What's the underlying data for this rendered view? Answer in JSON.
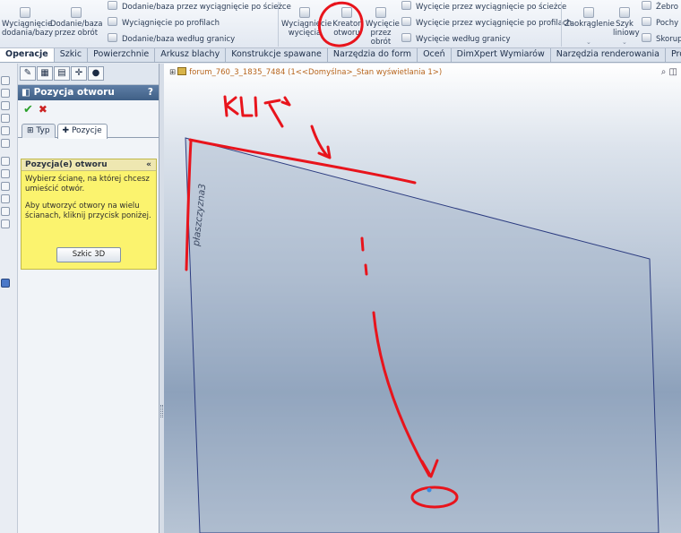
{
  "ribbon": {
    "btn_wyciagniecie": "Wyciągnięcie dodania/bazy",
    "btn_obrot": "Dodanie/baza przez obrót",
    "row_sciezka": "Dodanie/baza przez wyciągnięcie po ścieżce",
    "row_profile": "Wyciągnięcie po profilach",
    "row_granica": "Dodanie/baza według granicy",
    "btn_wyc_wyc": "Wyciągnięcie wycięcia",
    "btn_kreator": "Kreator otworu",
    "btn_wyc_obrot": "Wycięcie przez obrót",
    "row_cut_sciezka": "Wycięcie przez wyciągnięcie po ścieżce",
    "row_cut_profile": "Wycięcie przez wyciągnięcie po profilach",
    "row_cut_granica": "Wycięcie według granicy",
    "btn_zaokraglenie": "Zaokrąglenie",
    "btn_szyk": "Szyk liniowy",
    "row_zebro": "Żebro",
    "row_pochylenie": "Pochy",
    "row_skorupa": "Skorup"
  },
  "tabs": [
    "Operacje",
    "Szkic",
    "Powierzchnie",
    "Arkusz blachy",
    "Konstrukcje spawane",
    "Narzędzia do form",
    "Oceń",
    "DimXpert Wymiarów",
    "Narzędzia renderowania",
    "Produkty Office"
  ],
  "property_manager": {
    "title": "Pozycja otworu",
    "help": "?",
    "subtab_typ": "Typ",
    "subtab_pozycje": "Pozycje",
    "group_title": "Pozycja(e) otworu",
    "instruction1": "Wybierz ścianę, na której chcesz umieścić otwór.",
    "instruction2": "Aby utworzyć otwory na wielu ścianach, kliknij przycisk poniżej.",
    "sketch_button": "Szkic 3D"
  },
  "viewport": {
    "breadcrumb": "forum_760_3_1835_7484  (1<<Domyślna>_Stan wyświetlania 1>)",
    "plane_label": "płaszczyzna3"
  },
  "annotations": {
    "handwritten_text": "KLIK",
    "marker_color": "#e8141c"
  },
  "colors": {
    "ribbon_bg": "#e2e8f1",
    "title_bar": "#4f6f96",
    "group_bg": "#fbf36e",
    "breadcrumb": "#b7651d"
  }
}
